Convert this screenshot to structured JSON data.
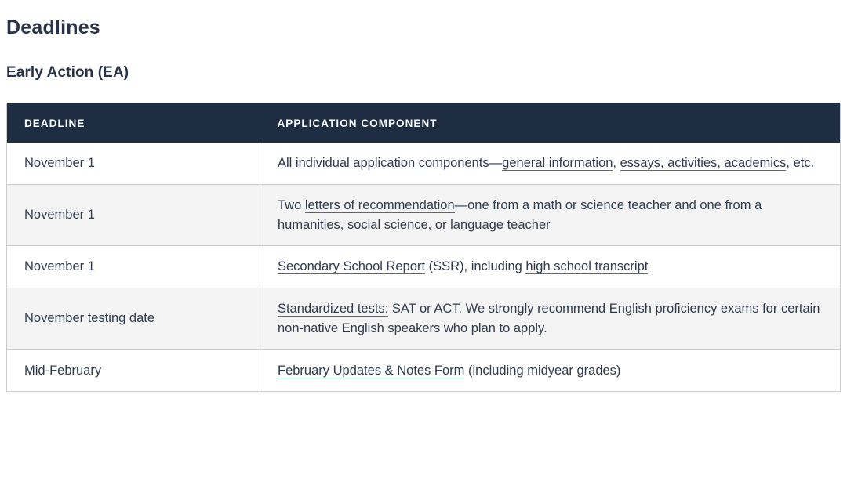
{
  "page": {
    "title": "Deadlines",
    "section_title": "Early Action (EA)"
  },
  "colors": {
    "header_background": "#1e2d42",
    "heading_text": "#28334a",
    "body_text": "#2f3a4d",
    "link_underline": "#3a7d54",
    "row_stripe": "#f4f4f4",
    "border": "#c9cacc"
  },
  "table": {
    "columns": [
      {
        "label": "DEADLINE"
      },
      {
        "label": "APPLICATION COMPONENT"
      }
    ],
    "rows": [
      {
        "deadline": "November 1",
        "component": {
          "parts": [
            {
              "type": "text",
              "text": "All individual application components—"
            },
            {
              "type": "link",
              "text": "general information"
            },
            {
              "type": "text",
              "text": ", "
            },
            {
              "type": "link",
              "text": "essays, activities, academics"
            },
            {
              "type": "text",
              "text": ", etc."
            }
          ]
        }
      },
      {
        "deadline": "November 1",
        "component": {
          "parts": [
            {
              "type": "text",
              "text": "Two "
            },
            {
              "type": "link",
              "text": "letters of recommendation"
            },
            {
              "type": "text",
              "text": "—one from a math or science teacher and one from a humanities, social science, or language teacher"
            }
          ]
        }
      },
      {
        "deadline": "November 1",
        "component": {
          "parts": [
            {
              "type": "link",
              "text": "Secondary School Report"
            },
            {
              "type": "text",
              "text": " (SSR), including "
            },
            {
              "type": "link",
              "text": "high school transcript"
            }
          ]
        }
      },
      {
        "deadline": "November testing date",
        "component": {
          "parts": [
            {
              "type": "link",
              "text": "Standardized tests:"
            },
            {
              "type": "text",
              "text": " SAT or ACT. We strongly recommend English proficiency exams for certain non-native English speakers who plan to apply."
            }
          ]
        }
      },
      {
        "deadline": "Mid-February",
        "component": {
          "parts": [
            {
              "type": "link",
              "text": "February Updates & Notes Form"
            },
            {
              "type": "text",
              "text": " (including midyear grades)"
            }
          ]
        }
      }
    ]
  }
}
